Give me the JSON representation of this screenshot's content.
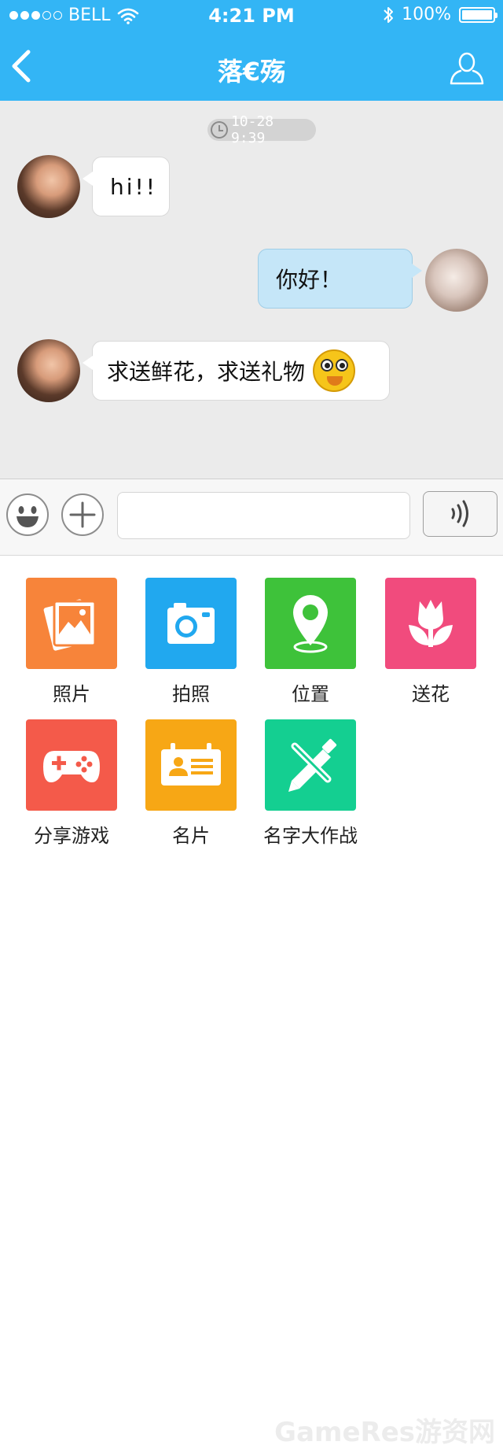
{
  "status_bar": {
    "carrier": "BELL",
    "time": "4:21 PM",
    "battery": "100%",
    "signal_bars_filled": 3,
    "signal_bars_total": 5,
    "battery_level": 1.0
  },
  "nav": {
    "title": "落€殇",
    "back_icon": "chevron-left-icon",
    "profile_icon": "user-icon"
  },
  "chat": {
    "timestamp": "10-28 9:39",
    "messages": [
      {
        "direction": "incoming",
        "text": "hi!!"
      },
      {
        "direction": "outgoing",
        "text": "你好！"
      },
      {
        "direction": "incoming",
        "text": "求送鲜花，求送礼物",
        "emoji": "blushing-face-emoji"
      }
    ]
  },
  "input": {
    "value": "",
    "emoji_icon": "smiley-icon",
    "plus_icon": "plus-icon",
    "voice_icon": "voice-wave-icon"
  },
  "actions": [
    {
      "label": "照片",
      "icon": "photo-icon",
      "color": "#f7843a"
    },
    {
      "label": "拍照",
      "icon": "camera-icon",
      "color": "#21a8ef"
    },
    {
      "label": "位置",
      "icon": "location-pin-icon",
      "color": "#3ec23a"
    },
    {
      "label": "送花",
      "icon": "tulip-icon",
      "color": "#f14b7d"
    },
    {
      "label": "分享游戏",
      "icon": "gamepad-icon",
      "color": "#f45a4a"
    },
    {
      "label": "名片",
      "icon": "id-card-icon",
      "color": "#f7a715"
    },
    {
      "label": "名字大作战",
      "icon": "pencil-icon",
      "color": "#14cf91"
    }
  ],
  "watermark": "GameRes游资网",
  "colors": {
    "header": "#33b5f5",
    "chat_background": "#ebebeb",
    "outgoing_bubble": "#c5e6f8",
    "incoming_bubble": "#ffffff"
  }
}
